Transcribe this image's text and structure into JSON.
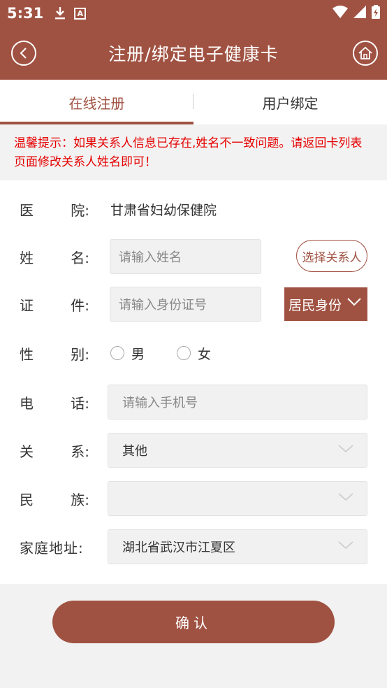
{
  "status_bar": {
    "time": "5:31",
    "a_icon_text": "A"
  },
  "header": {
    "title": "注册/绑定电子健康卡"
  },
  "tabs": [
    {
      "label": "在线注册",
      "active": true
    },
    {
      "label": "用户绑定",
      "active": false
    }
  ],
  "notice": "温馨提示：如果关系人信息已存在,姓名不一致问题。请返回卡列表页面修改关系人姓名即可！",
  "form": {
    "hospital": {
      "label_a": "医",
      "label_b": "院:",
      "value": "甘肃省妇幼保健院"
    },
    "name": {
      "label_a": "姓",
      "label_b": "名:",
      "placeholder": "请输入姓名",
      "select_contact_label": "选择关系人"
    },
    "id": {
      "label_a": "证",
      "label_b": "件:",
      "placeholder": "请输入身份证号",
      "id_type": "居民身份"
    },
    "gender": {
      "label_a": "性",
      "label_b": "别:",
      "options": [
        "男",
        "女"
      ]
    },
    "phone": {
      "label_a": "电",
      "label_b": "话:",
      "placeholder": "请输入手机号"
    },
    "relation": {
      "label_a": "关",
      "label_b": "系:",
      "value": "其他"
    },
    "ethnicity": {
      "label_a": "民",
      "label_b": "族:",
      "value": ""
    },
    "address": {
      "label": "家庭地址:",
      "value": "湖北省武汉市江夏区"
    }
  },
  "confirm_label": "确认",
  "colors": {
    "primary": "#a05242",
    "notice": "#e60000"
  }
}
